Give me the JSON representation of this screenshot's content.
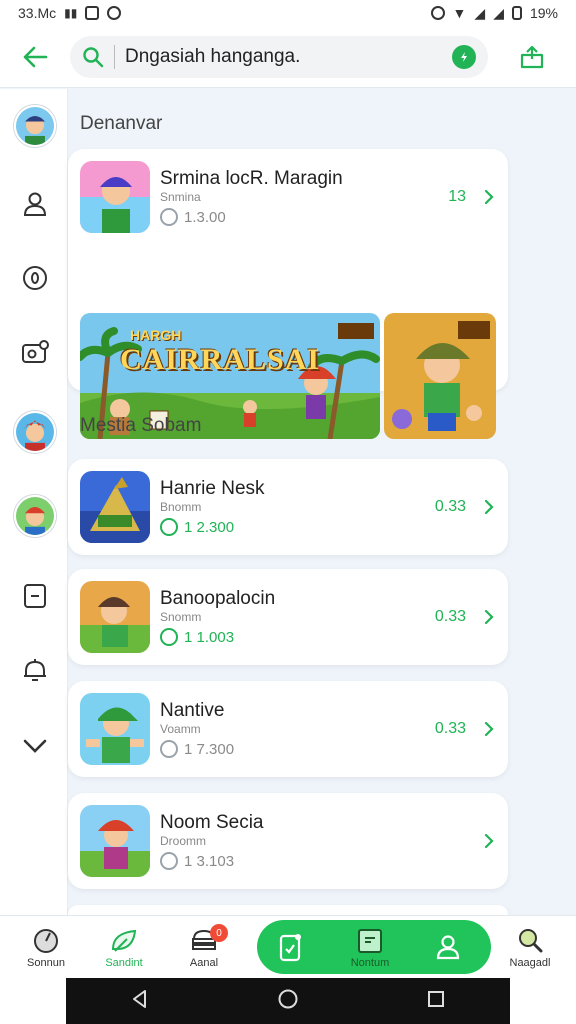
{
  "status_bar": {
    "left_text": "33.Mc",
    "right_text": "19%"
  },
  "search": {
    "query": "Dngasiah hanganga."
  },
  "sections": [
    {
      "label": "Denanvar"
    },
    {
      "label": "Mestia Sobam"
    }
  ],
  "featured": {
    "title": "Srmina locR. Maragin",
    "subtitle": "Snmina",
    "meta": "1.3.00",
    "price": "13",
    "banner_text": "CAIRRALSAI",
    "banner_tag": "HARGH"
  },
  "apps": [
    {
      "title": "Hanrie Nesk",
      "subtitle": "Bnomm",
      "meta": "1 2.300",
      "price": "0.33",
      "meta_green": true
    },
    {
      "title": "Banoopalocin",
      "subtitle": "Snomm",
      "meta": "1 1.003",
      "price": "0.33",
      "meta_green": true
    },
    {
      "title": "Nantive",
      "subtitle": "Voamm",
      "meta": "1 7.300",
      "price": "0.33",
      "meta_green": false
    },
    {
      "title": "Noom Secia",
      "subtitle": "Droomm",
      "meta": "1 3.103",
      "price": "",
      "meta_green": false
    }
  ],
  "bottom_nav": [
    {
      "label": "Sonnun",
      "icon": "compass-icon"
    },
    {
      "label": "Sandint",
      "icon": "leaf-icon"
    },
    {
      "label": "Aanal",
      "icon": "cloud-stack-icon",
      "badge": "0"
    },
    {
      "label": "",
      "icon": "phone-check-icon"
    },
    {
      "label": "Nontum",
      "icon": "card-icon"
    },
    {
      "label": "",
      "icon": "person-icon"
    },
    {
      "label": "Naagadl",
      "icon": "magnifier-icon"
    }
  ],
  "colors": {
    "accent": "#21b356",
    "pill": "#21c45a",
    "badge": "#ef4b36",
    "background": "#eef4fa"
  }
}
